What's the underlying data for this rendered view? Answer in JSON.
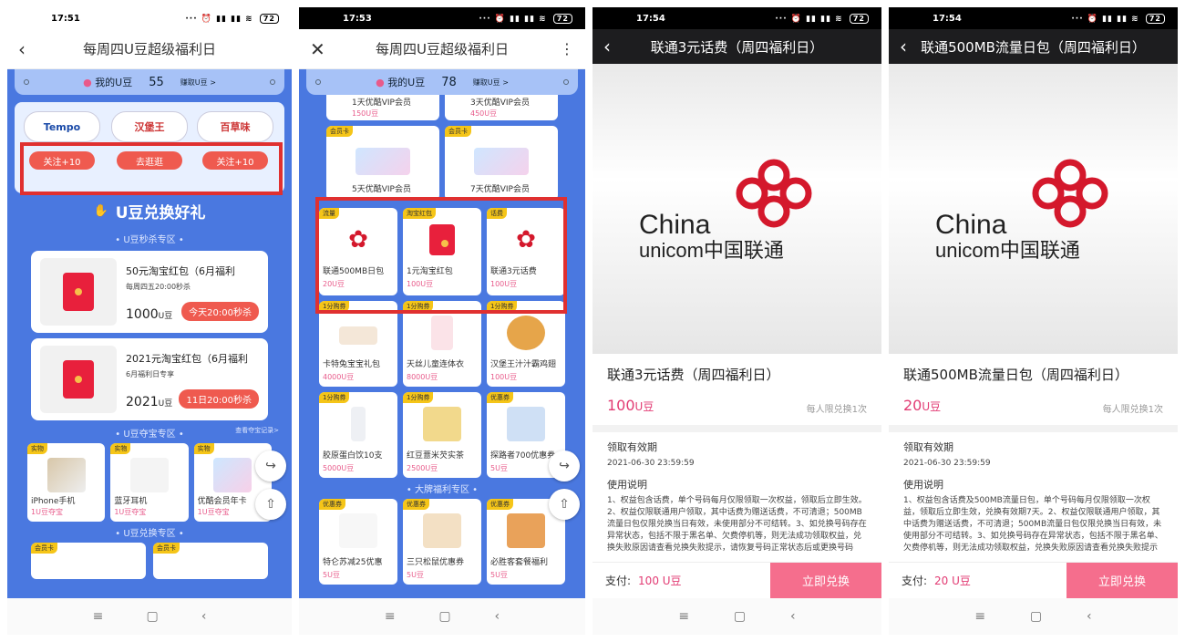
{
  "screen1": {
    "time": "17:51",
    "battery": "72",
    "title": "每周四U豆超级福利日",
    "my_u": "我的U豆",
    "u_count": "55",
    "earn": "赚取U豆 >",
    "brands": [
      "Tempo",
      "汉堡王",
      "百草味"
    ],
    "follow1": "关注+10",
    "go": "去逛逛",
    "follow2": "关注+10",
    "heading": "U豆兑换好礼",
    "sec1": "U豆秒杀专区",
    "cards": [
      {
        "title": "50元淘宝红包（6月福利",
        "sub": "每周四五20:00秒杀",
        "price": "1000",
        "unit": "U豆",
        "btn": "今天20:00秒杀"
      },
      {
        "title": "2021元淘宝红包（6月福利",
        "sub": "6月福利日专享",
        "price": "2021",
        "unit": "U豆",
        "btn": "11日20:00秒杀"
      }
    ],
    "sec2": "U豆夺宝专区",
    "record": "查看夺宝记录>",
    "treasures": [
      {
        "tag": "实物",
        "name": "iPhone手机",
        "price": "1U豆夺宝"
      },
      {
        "tag": "实物",
        "name": "蓝牙耳机",
        "price": "1U豆夺宝"
      },
      {
        "tag": "实物",
        "name": "优酷会员年卡",
        "price": "1U豆夺宝"
      }
    ],
    "sec3": "U豆兑换专区",
    "vip_tag": "会员卡"
  },
  "screen2": {
    "time": "17:53",
    "battery": "72",
    "title": "每周四U豆超级福利日",
    "my_u": "我的U豆",
    "u_count": "78",
    "earn": "赚取U豆 >",
    "rows": [
      [
        {
          "tag": "",
          "name": "1天优酷VIP会员",
          "price": "150U豆"
        },
        {
          "tag": "",
          "name": "3天优酷VIP会员",
          "price": "450U豆"
        }
      ],
      [
        {
          "tag": "会员卡",
          "name": "5天优酷VIP会员",
          "price": ""
        },
        {
          "tag": "会员卡",
          "name": "7天优酷VIP会员",
          "price": ""
        }
      ]
    ],
    "grid": [
      {
        "tag": "流量",
        "name": "联通500MB日包",
        "price": "20U豆"
      },
      {
        "tag": "淘宝红包",
        "name": "1元淘宝红包",
        "price": "100U豆"
      },
      {
        "tag": "话费",
        "name": "联通3元话费",
        "price": "100U豆"
      },
      {
        "tag": "1分购券",
        "name": "卡特兔宝宝礼包",
        "price": "4000U豆"
      },
      {
        "tag": "1分购券",
        "name": "天丝儿童连体衣",
        "price": "8000U豆"
      },
      {
        "tag": "1分购券",
        "name": "汉堡王汁汁霸鸡翅",
        "price": "100U豆"
      },
      {
        "tag": "1分购券",
        "name": "胶原蛋白饮10支",
        "price": "5000U豆"
      },
      {
        "tag": "1分购券",
        "name": "红豆薏米芡实茶",
        "price": "2500U豆"
      },
      {
        "tag": "优惠券",
        "name": "探路者700优惠券",
        "price": "5U豆"
      }
    ],
    "brand_sec": "大牌福利专区",
    "grid2": [
      {
        "tag": "优惠券",
        "name": "特仑苏减25优惠",
        "price": "5U豆"
      },
      {
        "tag": "优惠券",
        "name": "三只松鼠优惠券",
        "price": "5U豆"
      },
      {
        "tag": "优惠券",
        "name": "必胜客套餐福利",
        "price": "5U豆"
      }
    ]
  },
  "screen3": {
    "time": "17:54",
    "battery": "72",
    "bar_title": "联通3元话费（周四福利日）",
    "product_title": "联通3元话费（周四福利日）",
    "price": "100",
    "unit": "U豆",
    "limit": "每人限兑换1次",
    "validity_label": "领取有效期",
    "validity": "2021-06-30 23:59:59",
    "usage_label": "使用说明",
    "usage": "1、权益包含话费，单个号码每月仅限领取一次权益，领取后立即生效。2、权益仅限联通用户领取，其中话费为赠送话费，不可清退；500MB流量日包仅限兑换当日有效，未使用部分不可结转。3、如兑换号码存在异常状态，包括不限于黑名单、欠费停机等，则无法成功领取权益，兑换失败原因请查看兑换失败提示，请恢复号码正常状态后或更换号码",
    "pay_label": "支付:",
    "pay_amount": "100 U豆",
    "btn": "立即兑换"
  },
  "screen4": {
    "time": "17:54",
    "battery": "72",
    "bar_title": "联通500MB流量日包（周四福利日）",
    "product_title": "联通500MB流量日包（周四福利日）",
    "price": "20",
    "unit": "U豆",
    "limit": "每人限兑换1次",
    "validity_label": "领取有效期",
    "validity": "2021-06-30 23:59:59",
    "usage_label": "使用说明",
    "usage": "1、权益包含话费及500MB流量日包，单个号码每月仅限领取一次权益，领取后立即生效，兑换有效期7天。2、权益仅限联通用户领取，其中话费为赠送话费，不可清退；500MB流量日包仅限兑换当日有效，未使用部分不可结转。3、如兑换号码存在异常状态，包括不限于黑名单、欠费停机等，则无法成功领取权益，兑换失败原因请查看兑换失败提示",
    "pay_label": "支付:",
    "pay_amount": "20 U豆",
    "btn": "立即兑换"
  },
  "logo_text1": "China",
  "logo_text2": "unicom中国联通",
  "colors": {
    "accent": "#e23b73",
    "mall_blue": "#4a78e0",
    "red_box": "#e03030",
    "pink_btn": "#f56e8d"
  }
}
